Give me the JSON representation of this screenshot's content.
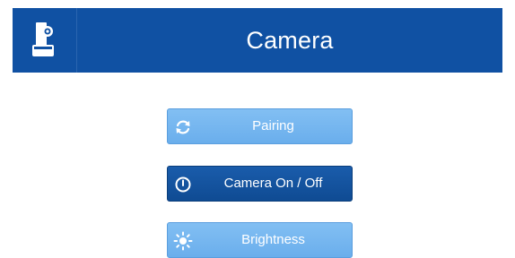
{
  "header": {
    "title": "Camera",
    "icon": "camera-device-icon"
  },
  "buttons": [
    {
      "label": "Pairing",
      "icon": "refresh-icon",
      "style": "light"
    },
    {
      "label": "Camera On / Off",
      "icon": "power-icon",
      "style": "dark"
    },
    {
      "label": "Brightness",
      "icon": "sun-icon",
      "style": "light"
    }
  ],
  "colors": {
    "header_bg": "#1051a3",
    "button_light": "#72b4ef",
    "button_dark": "#114e98",
    "text": "#ffffff"
  }
}
